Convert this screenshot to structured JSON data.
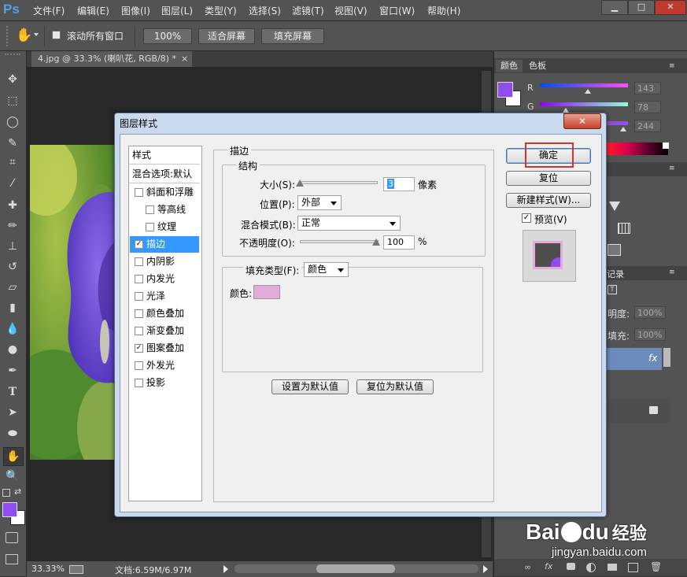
{
  "app": {
    "logo": "Ps"
  },
  "menu": [
    "文件(F)",
    "编辑(E)",
    "图像(I)",
    "图层(L)",
    "类型(Y)",
    "选择(S)",
    "滤镜(T)",
    "视图(V)",
    "窗口(W)",
    "帮助(H)"
  ],
  "window_buttons": {
    "minimize": "▁",
    "maximize": "□",
    "close": "✕"
  },
  "options": {
    "scroll_all_label": "滚动所有窗口",
    "zoom_100": "100%",
    "fit_screen": "适合屏幕",
    "fill_screen": "填充屏幕"
  },
  "document": {
    "tab_title": "4.jpg @ 33.3% (喇叭花, RGB/8) *",
    "tab_close": "×"
  },
  "status": {
    "zoom": "33.33%",
    "doc_info": "文档:6.59M/6.97M"
  },
  "right_panel": {
    "tabs": [
      "颜色",
      "色板"
    ],
    "r_label": "R",
    "g_label": "G",
    "r_value": "143",
    "g_value": "78",
    "b_value": "244",
    "layers_tab": "记录",
    "opacity_label": "明度:",
    "opacity_value": "100%",
    "fill_label": "填充:",
    "fill_value": "100%",
    "fx_label": "fx"
  },
  "colors": {
    "foreground": "#8e4cf2",
    "stroke_color": "#e3acd8",
    "accent_highlight": "#d9302a",
    "dialog_selected": "#3399ff"
  },
  "dialog": {
    "title": "图层样式",
    "close": "✕",
    "style_list_header": "样式",
    "blend_options": "混合选项:默认",
    "items": [
      {
        "label": "斜面和浮雕",
        "checked": false,
        "indent": false,
        "selected": false
      },
      {
        "label": "等高线",
        "checked": false,
        "indent": true,
        "selected": false
      },
      {
        "label": "纹理",
        "checked": false,
        "indent": true,
        "selected": false
      },
      {
        "label": "描边",
        "checked": true,
        "indent": false,
        "selected": true
      },
      {
        "label": "内阴影",
        "checked": false,
        "indent": false,
        "selected": false
      },
      {
        "label": "内发光",
        "checked": false,
        "indent": false,
        "selected": false
      },
      {
        "label": "光泽",
        "checked": false,
        "indent": false,
        "selected": false
      },
      {
        "label": "颜色叠加",
        "checked": false,
        "indent": false,
        "selected": false
      },
      {
        "label": "渐变叠加",
        "checked": false,
        "indent": false,
        "selected": false
      },
      {
        "label": "图案叠加",
        "checked": true,
        "indent": false,
        "selected": false
      },
      {
        "label": "外发光",
        "checked": false,
        "indent": false,
        "selected": false
      },
      {
        "label": "投影",
        "checked": false,
        "indent": false,
        "selected": false
      }
    ],
    "section_title": "描边",
    "structure_title": "结构",
    "size_label": "大小(S):",
    "size_value": "3",
    "size_unit": "像素",
    "position_label": "位置(P):",
    "position_value": "外部",
    "blend_mode_label": "混合模式(B):",
    "blend_mode_value": "正常",
    "opacity_label": "不透明度(O):",
    "opacity_value": "100",
    "opacity_unit": "%",
    "fill_type_label": "填充类型(F):",
    "fill_type_value": "颜色",
    "color_label": "颜色:",
    "set_default": "设置为默认值",
    "reset_default": "复位为默认值",
    "ok": "确定",
    "reset": "复位",
    "new_style": "新建样式(W)...",
    "preview_label": "预览(V)",
    "preview_checked": true
  },
  "watermark": {
    "brand": "Bai",
    "brand2": "du",
    "brand_cn": "经验",
    "url": "jingyan.baidu.com"
  }
}
